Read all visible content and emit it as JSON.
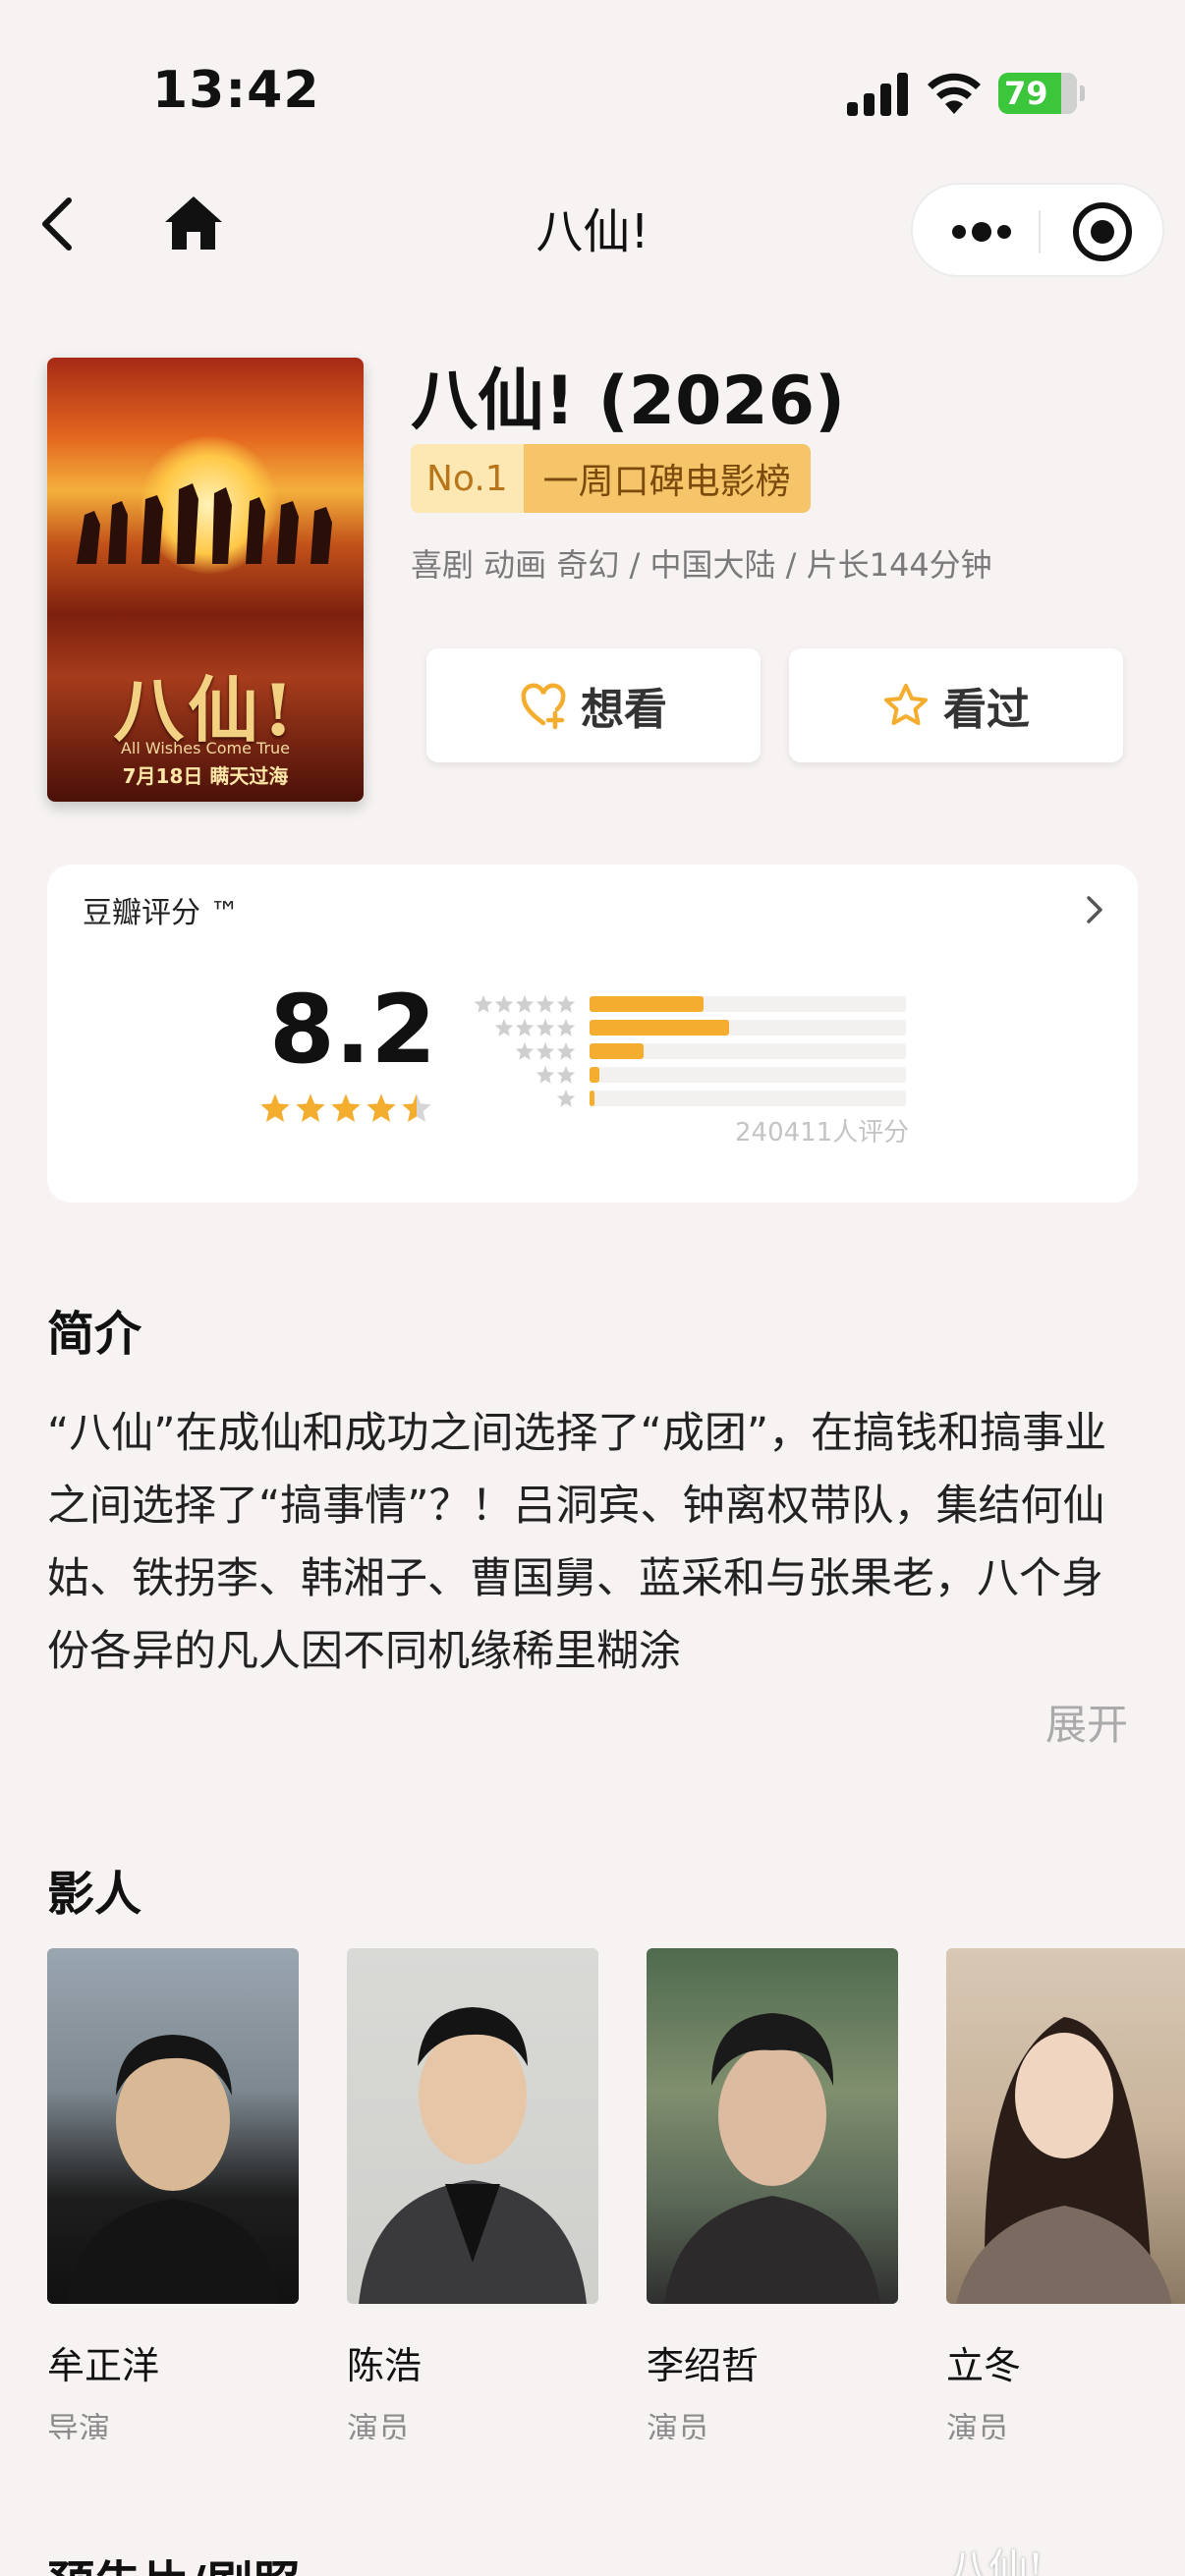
{
  "status_bar": {
    "time": "13:42",
    "battery": "79"
  },
  "nav": {
    "title": "八仙!"
  },
  "poster": {
    "title_art": "八仙!",
    "subtitle": "All Wishes Come True",
    "release": "7月18日 瞒天过海"
  },
  "movie": {
    "title": "八仙! (2026)",
    "rank_no": "No.1",
    "rank_label": "一周口碑电影榜",
    "meta": "喜剧 动画 奇幻 / 中国大陆 / 片长144分钟",
    "want_label": "想看",
    "seen_label": "看过"
  },
  "rating": {
    "title": "豆瓣评分 ™",
    "score": "8.2",
    "stars": 4.5,
    "count": "240411人评分",
    "distribution": [
      {
        "stars": 5,
        "fraction": 0.36
      },
      {
        "stars": 4,
        "fraction": 0.44
      },
      {
        "stars": 3,
        "fraction": 0.17
      },
      {
        "stars": 2,
        "fraction": 0.03
      },
      {
        "stars": 1,
        "fraction": 0.01
      }
    ],
    "accent": "#f5ad2f"
  },
  "synopsis": {
    "title": "简介",
    "text": "“八仙”在成仙和成功之间选择了“成团”，在搞钱和搞事业之间选择了“搞事情”？！吕洞宾、钟离权带队，集结何仙姑、铁拐李、韩湘子、曹国舅、蓝采和与张果老，八个身份各异的凡人因不同机缘稀里糊涂",
    "expand": "展开"
  },
  "cast": {
    "title": "影人",
    "items": [
      {
        "name": "牟正洋",
        "role": "导演"
      },
      {
        "name": "陈浩",
        "role": "演员"
      },
      {
        "name": "李绍哲",
        "role": "演员"
      },
      {
        "name": "立冬",
        "role": "演员"
      }
    ]
  },
  "trailer": {
    "title": "预告片/剧照"
  },
  "watermark": "八仙!"
}
